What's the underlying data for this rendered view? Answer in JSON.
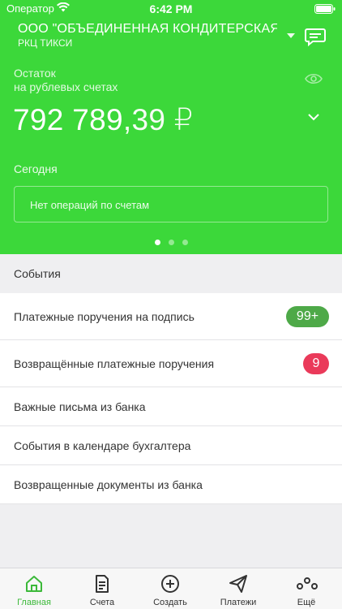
{
  "status_bar": {
    "carrier": "Оператор",
    "time": "6:42 PM"
  },
  "header": {
    "org_name": "ООО \"ОБЪЕДИНЕННАЯ КОНДИТЕРСКАЯ СЕ",
    "branch": "РКЦ ТИКСИ"
  },
  "balance": {
    "label_line1": "Остаток",
    "label_line2": "на рублевых счетах",
    "amount_main": "792 789",
    "amount_cents": ",39 ₽"
  },
  "today": {
    "label": "Сегодня",
    "empty_text": "Нет операций по счетам"
  },
  "pager": {
    "count": 3,
    "active": 0
  },
  "events": {
    "header": "События",
    "items": [
      {
        "label": "Платежные поручения на подпись",
        "badge": "99+",
        "badge_color": "#4ea948"
      },
      {
        "label": "Возвращённые платежные поручения",
        "badge": "9",
        "badge_color": "#ea3a5a"
      },
      {
        "label": "Важные письма из банка"
      },
      {
        "label": "События в календаре бухгалтера"
      },
      {
        "label": "Возвращенные документы из банка"
      }
    ]
  },
  "tabbar": {
    "items": [
      {
        "label": "Главная",
        "icon": "home-icon",
        "active": true
      },
      {
        "label": "Счета",
        "icon": "document-icon"
      },
      {
        "label": "Создать",
        "icon": "plus-circle-icon"
      },
      {
        "label": "Платежи",
        "icon": "paper-plane-icon"
      },
      {
        "label": "Ещё",
        "icon": "more-dots-icon"
      }
    ]
  },
  "colors": {
    "brand_green": "#3cd83a",
    "tab_active": "#3cb93a"
  }
}
